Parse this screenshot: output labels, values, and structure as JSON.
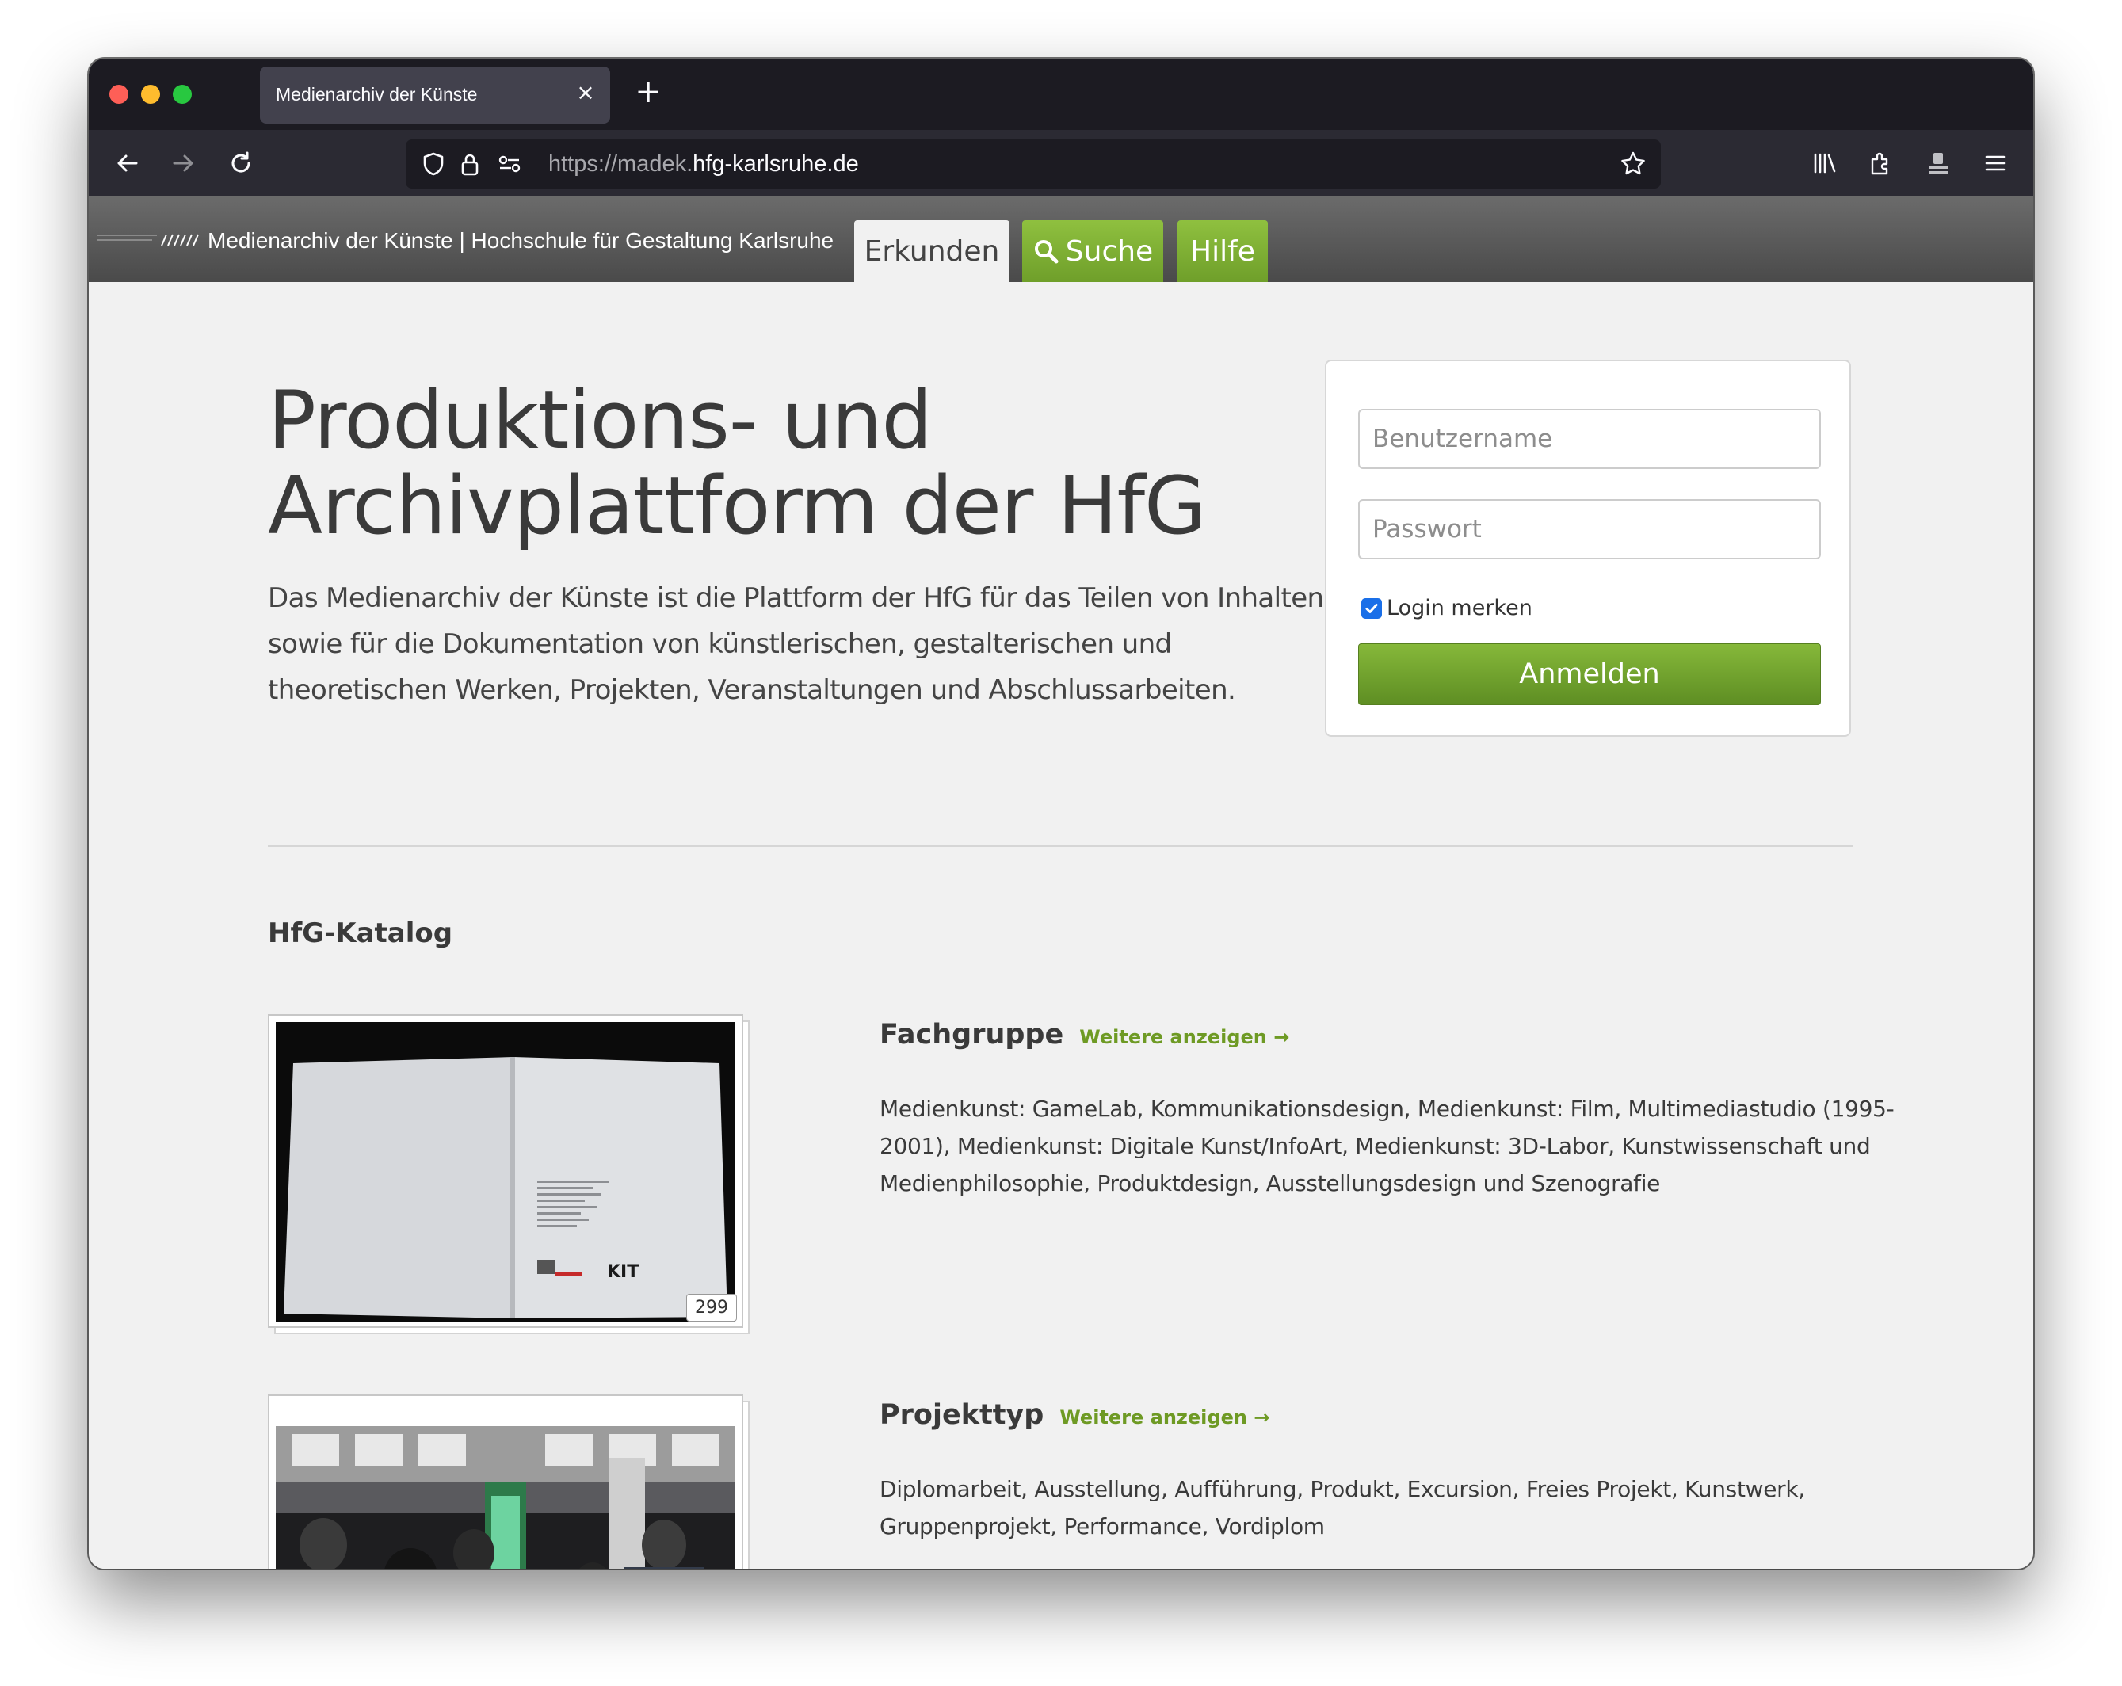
{
  "browser": {
    "tab_title": "Medienarchiv der Künste",
    "url_prefix": "https://madek.",
    "url_domain": "hfg-karlsruhe.de"
  },
  "site": {
    "brand": "Medienarchiv der Künste | Hochschule für Gestaltung Karlsruhe",
    "nav": {
      "erkunden": "Erkunden",
      "suche": "Suche",
      "hilfe": "Hilfe"
    },
    "accent_color": "#7aa832"
  },
  "hero": {
    "title_line1": "Produktions- und",
    "title_line2": "Archivplattform der HfG",
    "description": "Das Medienarchiv der Künste ist die Plattform der HfG für das Teilen von Inhalten sowie für die Dokumentation von künstlerischen, gestalterischen und theoretischen Werken, Projekten, Veranstaltungen und Abschlussarbeiten."
  },
  "login": {
    "username_placeholder": "Benutzername",
    "password_placeholder": "Passwort",
    "remember_label": "Login merken",
    "remember_checked": true,
    "submit_label": "Anmelden"
  },
  "catalog": {
    "title": "HfG-Katalog",
    "more_label": "Weitere anzeigen →",
    "sections": [
      {
        "name": "Fachgruppe",
        "count": "299",
        "items": "Medienkunst: GameLab, Kommunikationsdesign, Medienkunst: Film, Multimediastudio (1995-2001), Medienkunst: Digitale Kunst/InfoArt, Medienkunst: 3D-Labor, Kunstwissenschaft und Medienphilosophie, Produktdesign, Ausstellungsdesign und Szenografie"
      },
      {
        "name": "Projekttyp",
        "items": "Diplomarbeit, Ausstellung, Aufführung, Produkt, Excursion, Freies Projekt, Kunstwerk, Gruppenprojekt, Performance, Vordiplom"
      }
    ]
  },
  "icons": [
    "close-icon",
    "plus-icon",
    "back-icon",
    "forward-icon",
    "reload-icon",
    "shield-icon",
    "lock-icon",
    "permissions-icon",
    "star-icon",
    "library-icon",
    "extensions-icon",
    "account-icon",
    "menu-icon",
    "search-icon",
    "check-icon"
  ]
}
